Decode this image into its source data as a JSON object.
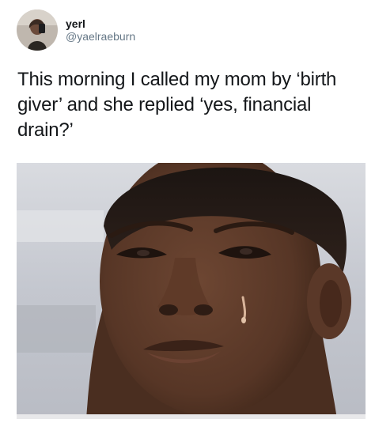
{
  "post": {
    "display_name": "yerl",
    "handle": "@yaelraeburn",
    "text": "This morning I called my mom by ‘birth giver’ and she replied ‘yes, financial drain?’"
  },
  "avatar": {
    "icon": "user-avatar-photo"
  },
  "photo": {
    "icon": "crying-boy-meme-photo",
    "colors": {
      "skin": "#5a3a28",
      "background": "#c9ccd2",
      "tear": "#d8b49a"
    }
  }
}
